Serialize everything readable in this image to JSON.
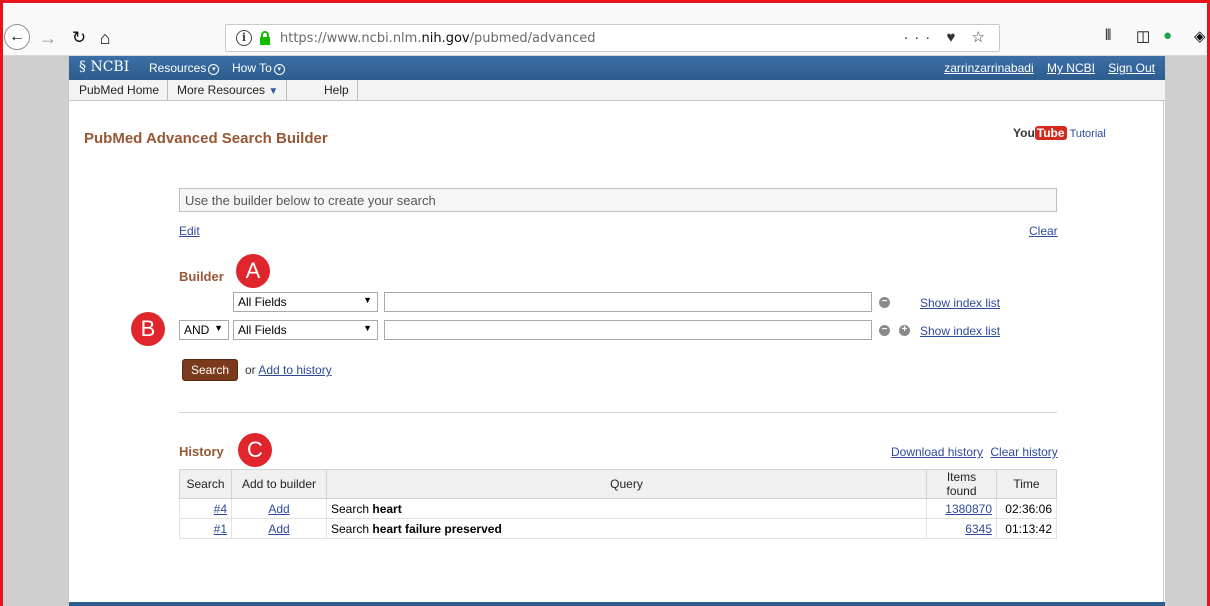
{
  "browser": {
    "url_prefix": "https://www.ncbi.nlm.",
    "url_domain": "nih.gov",
    "url_path": "/pubmed/advanced",
    "url_actions": "··· ♥ ☆"
  },
  "ncbi_bar": {
    "logo": "NCBI",
    "resources": "Resources",
    "howto": "How To",
    "user": "zarrinzarrinabadi",
    "my_ncbi": "My NCBI",
    "sign_out": "Sign Out"
  },
  "subnav": {
    "home": "PubMed Home",
    "more": "More Resources",
    "help": "Help"
  },
  "page": {
    "title": "PubMed Advanced Search Builder",
    "yt_you": "You",
    "yt_tube": "Tube",
    "tutorial": "Tutorial",
    "query_placeholder": "Use the builder below to create your search",
    "edit": "Edit",
    "clear": "Clear"
  },
  "markers": {
    "a": "A",
    "b": "B",
    "c": "C"
  },
  "builder": {
    "label": "Builder",
    "row1_field": "All Fields",
    "row2_op": "AND",
    "row2_field": "All Fields",
    "show_index": "Show index list",
    "search_btn": "Search",
    "or": "or",
    "add_history": "Add to history"
  },
  "history": {
    "label": "History",
    "download": "Download history",
    "clear": "Clear history",
    "headers": [
      "Search",
      "Add to builder",
      "Query",
      "Items found",
      "Time"
    ],
    "rows": [
      {
        "id": "#4",
        "add": "Add",
        "prefix": "Search",
        "term": "heart",
        "items": "1380870",
        "time": "02:36:06"
      },
      {
        "id": "#1",
        "add": "Add",
        "prefix": "Search",
        "term": "heart failure preserved",
        "items": "6345",
        "time": "01:13:42"
      }
    ]
  }
}
